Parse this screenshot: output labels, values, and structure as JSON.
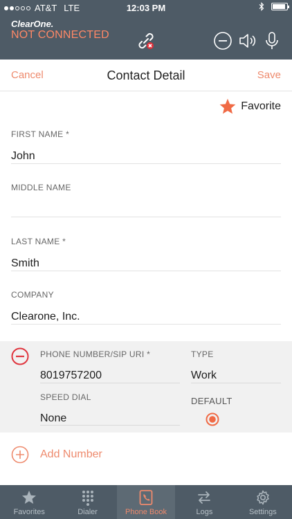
{
  "status_bar": {
    "carrier": "AT&T",
    "network": "LTE",
    "time": "12:03 PM",
    "battery_level": 0.9
  },
  "header": {
    "logo": "ClearOne.",
    "connection_status": "NOT CONNECTED",
    "icons": [
      "broken-link-icon",
      "minus-circle-icon",
      "speaker-icon",
      "microphone-icon"
    ]
  },
  "navbar": {
    "cancel_label": "Cancel",
    "title": "Contact Detail",
    "save_label": "Save"
  },
  "favorite": {
    "label": "Favorite",
    "active": true
  },
  "fields": {
    "first_name": {
      "label": "FIRST NAME *",
      "value": "John"
    },
    "middle_name": {
      "label": "MIDDLE NAME",
      "value": ""
    },
    "last_name": {
      "label": "LAST NAME *",
      "value": "Smith"
    },
    "company": {
      "label": "COMPANY",
      "value": "Clearone, Inc."
    }
  },
  "phone": {
    "number_label": "PHONE NUMBER/SIP URI *",
    "number_value": "8019757200",
    "type_label": "TYPE",
    "type_value": "Work",
    "speed_dial_label": "SPEED DIAL",
    "speed_dial_value": "None",
    "default_label": "DEFAULT",
    "is_default": true
  },
  "add_number_label": "Add Number",
  "tabs": [
    {
      "label": "Favorites",
      "icon": "star-icon"
    },
    {
      "label": "Dialer",
      "icon": "keypad-icon"
    },
    {
      "label": "Phone Book",
      "icon": "phonebook-icon",
      "active": true
    },
    {
      "label": "Logs",
      "icon": "arrows-icon"
    },
    {
      "label": "Settings",
      "icon": "gear-icon"
    }
  ],
  "colors": {
    "header_bg": "#4e5b66",
    "accent": "#ee8a6d",
    "status_warning": "#ff8866",
    "favorite_star": "#f06a45",
    "phone_block_bg": "#f1f1f1"
  }
}
